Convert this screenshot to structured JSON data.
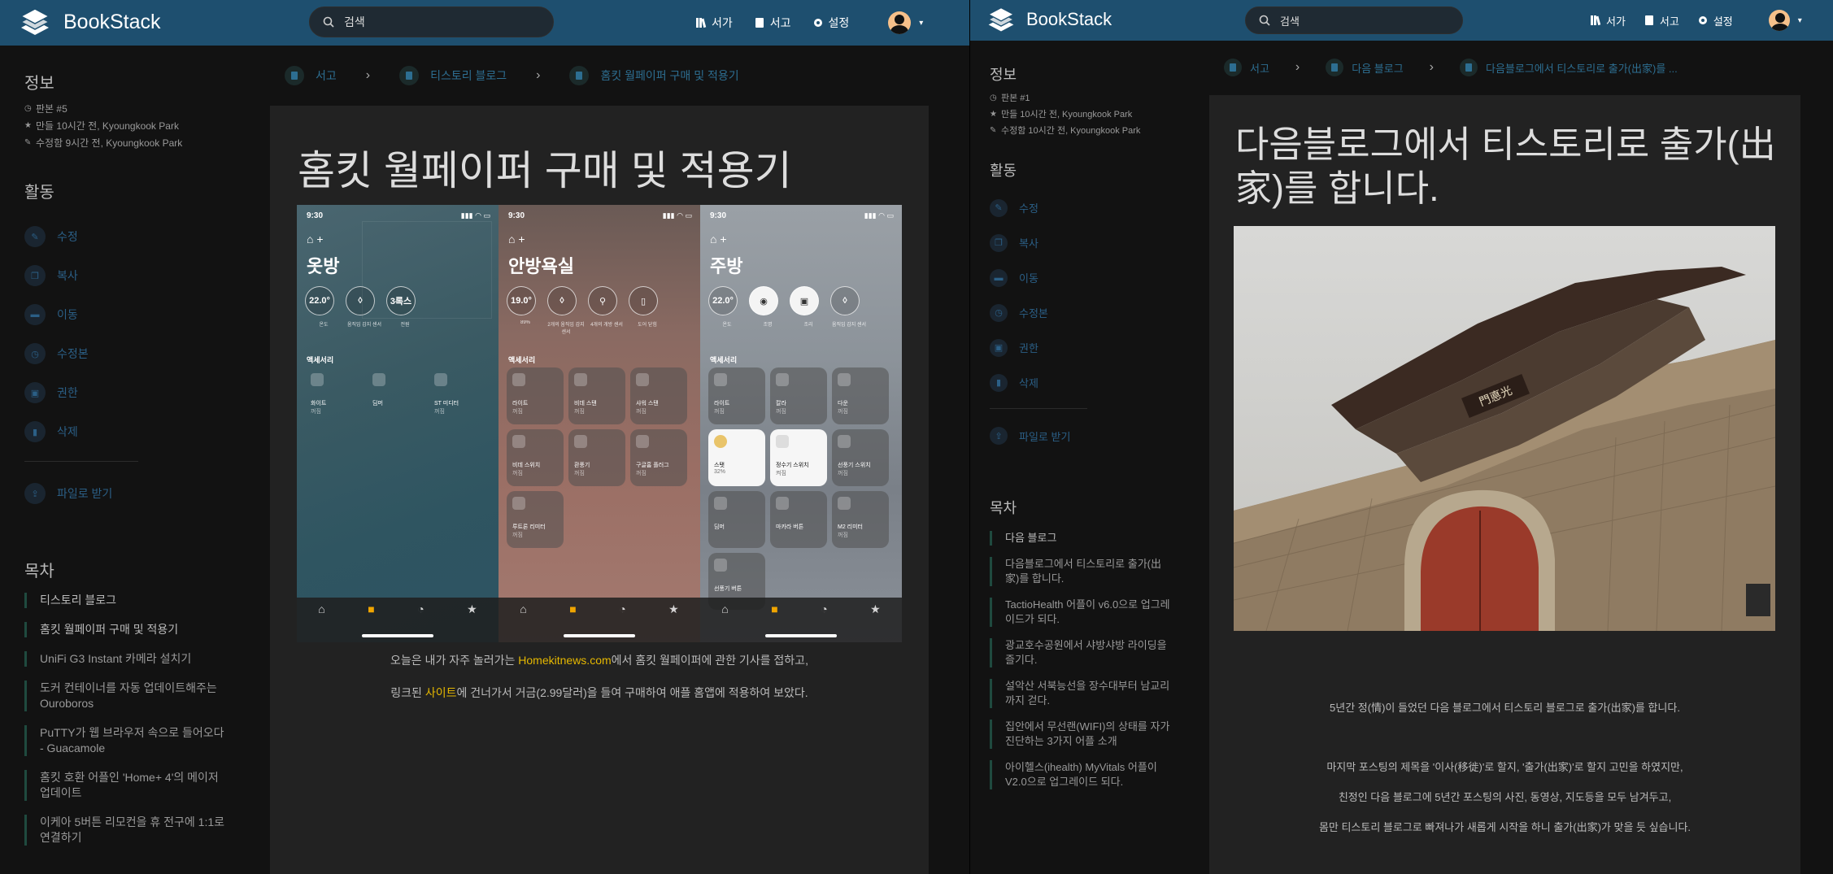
{
  "left": {
    "app_name": "BookStack",
    "search_placeholder": "검색",
    "nav": {
      "shelves": "서가",
      "books": "서고",
      "settings": "설정"
    },
    "info": {
      "heading": "정보",
      "revision": "판본 #5",
      "created": "만들 10시간 전, Kyoungkook Park",
      "updated": "수정함 9시간 전, Kyoungkook Park"
    },
    "activity": {
      "heading": "활동",
      "items": [
        "수정",
        "복사",
        "이동",
        "수정본",
        "권한",
        "삭제"
      ],
      "export": "파일로 받기"
    },
    "toc": {
      "heading": "목차",
      "items": [
        "티스토리 블로그",
        "홈킷 월페이퍼 구매 및 적용기",
        "UniFi G3 Instant 카메라 설치기",
        "도커 컨테이너를 자동 업데이트해주는 Ouroboros",
        "PuTTY가 웹 브라우저 속으로 들어오다 - Guacamole",
        "홈킷 호환 어플인 'Home+ 4'의 메이저 업데이트",
        "이케아 5버튼 리모컨을 휴 전구에 1:1로 연결하기"
      ]
    },
    "breadcrumb": [
      "서고",
      "티스토리 블로그",
      "홈킷 월페이퍼 구매 및 적용기"
    ],
    "page_title": "홈킷 월페이퍼 구매 및 적용기",
    "para1_pre": "오늘은 내가 자주 놀러가는 ",
    "para1_link": "Homekitnews.com",
    "para1_post": "에서 홈킷 월페이퍼에 관한 기사를 접하고,",
    "para2_pre": "링크된 ",
    "para2_link": "사이트",
    "para2_post": "에 건너가서 거금(2.99달러)을 들여 구매하여 애플 홈앱에 적용하여 보았다.",
    "phones": [
      {
        "time": "9:30",
        "room": "옷방",
        "sensors": [
          "22.0°",
          "",
          "3록스"
        ],
        "sensor_labels": [
          "온도",
          "움직임 감지 센서",
          "전원"
        ],
        "accessories_label": "액세서리",
        "tiles": [
          [
            "화이트",
            "꺼짐"
          ],
          [
            "딤머",
            ""
          ],
          [
            "ST 미디터",
            "꺼짐"
          ]
        ]
      },
      {
        "time": "9:30",
        "room": "안방욕실",
        "sensors": [
          "19.0°",
          "",
          "",
          ""
        ],
        "sensor_labels": [
          "89%",
          "2개의 움직임 감지 센서",
          "4개의 개방 센서",
          "도어 닫힘"
        ],
        "accessories_label": "액세서리",
        "tiles": [
          [
            "라이트",
            "꺼짐"
          ],
          [
            "비데 스탠",
            "꺼짐"
          ],
          [
            "샤워 스탠",
            "꺼짐"
          ],
          [
            "비데 스위치",
            "꺼짐"
          ],
          [
            "환풍기",
            "꺼짐"
          ],
          [
            "구글홈 플러그",
            "꺼짐"
          ],
          [
            "루트론 리미터",
            "꺼짐"
          ]
        ]
      },
      {
        "time": "9:30",
        "room": "주방",
        "sensors": [
          "22.0°",
          "",
          "",
          ""
        ],
        "sensor_labels": [
          "온도",
          "조명",
          "조리",
          "움직임 감지 센서"
        ],
        "accessories_label": "액세서리",
        "tiles": [
          [
            "라이트",
            "꺼짐"
          ],
          [
            "칼라",
            "꺼짐"
          ],
          [
            "다운",
            "꺼짐"
          ],
          [
            "스탯",
            "32%"
          ],
          [
            "정수기 스위치",
            "켜짐"
          ],
          [
            "선풍기 스위치",
            "꺼짐"
          ],
          [
            "딤머",
            ""
          ],
          [
            "마카라 버튼",
            ""
          ],
          [
            "M2 리미터",
            "꺼짐"
          ],
          [
            "선풍기 버튼",
            ""
          ]
        ]
      }
    ]
  },
  "right": {
    "app_name": "BookStack",
    "search_placeholder": "검색",
    "nav": {
      "shelves": "서가",
      "books": "서고",
      "settings": "설정"
    },
    "info": {
      "heading": "정보",
      "revision": "판본 #1",
      "created": "만들 10시간 전, Kyoungkook Park",
      "updated": "수정함 10시간 전, Kyoungkook Park"
    },
    "activity": {
      "heading": "활동",
      "items": [
        "수정",
        "복사",
        "이동",
        "수정본",
        "권한",
        "삭제"
      ],
      "export": "파일로 받기"
    },
    "toc": {
      "heading": "목차",
      "items": [
        "다음 블로그",
        "다음블로그에서 티스토리로 출가(出家)를 합니다.",
        "TactioHealth 어플이 v6.0으로 업그레이드가 되다.",
        "광교호수공원에서 샤방샤방 라이딩을 즐기다.",
        "설악산 서북능선을 장수대부터 남교리까지 걷다.",
        "집안에서 무선랜(WIFI)의 상태를 자가 진단하는 3가지 어플 소개",
        "아이헬스(ihealth) MyVitals 어플이 V2.0으로 업그레이드 되다."
      ]
    },
    "breadcrumb": [
      "서고",
      "다음 블로그",
      "다음블로그에서 티스토리로 출가(出家)를 ..."
    ],
    "page_title": "다음블로그에서 티스토리로 출가(出家)를 합니다.",
    "sign_text": "門悳光",
    "paragraphs": [
      "5년간 정(情)이 들었던 다음 블로그에서 티스토리 블로그로 출가(出家)를 합니다.",
      "마지막 포스팅의 제목을 '이사(移徙)'로 할지, '출가(出家)'로 할지 고민을 하였지만,",
      "친정인 다음 블로그에 5년간 포스팅의 사진, 동영상, 지도등을 모두 남겨두고,",
      "몸만 티스토리 블로그로 빠져나가 새롭게 시작을 하니 출가(出家)가 맞을 듯 싶습니다."
    ]
  }
}
